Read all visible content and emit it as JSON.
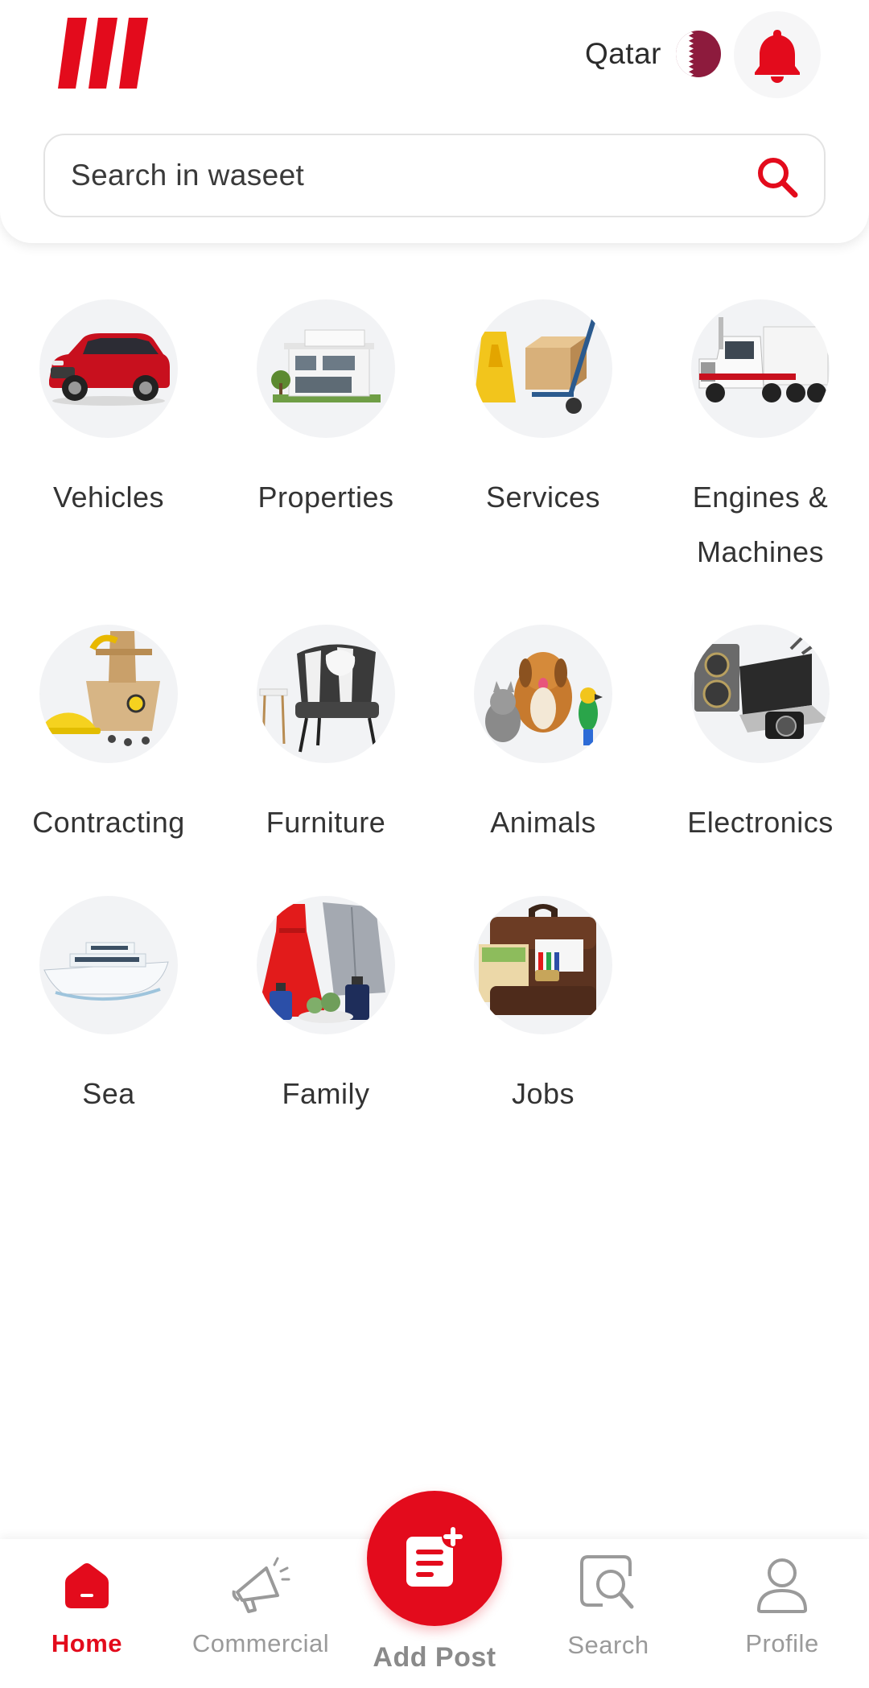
{
  "header": {
    "country": "Qatar",
    "search": {
      "placeholder": "Search in waseet"
    }
  },
  "brand_color": "#e30b1c",
  "categories": [
    {
      "label": "Vehicles",
      "icon": "car-icon"
    },
    {
      "label": "Properties",
      "icon": "house-icon"
    },
    {
      "label": "Services",
      "icon": "hand-truck-icon"
    },
    {
      "label": "Engines & Machines",
      "icon": "truck-icon"
    },
    {
      "label": "Contracting",
      "icon": "toolbox-icon"
    },
    {
      "label": "Furniture",
      "icon": "armchair-icon"
    },
    {
      "label": "Animals",
      "icon": "pets-icon"
    },
    {
      "label": "Electronics",
      "icon": "laptop-icon"
    },
    {
      "label": "Sea",
      "icon": "yacht-icon"
    },
    {
      "label": "Family",
      "icon": "clothing-icon"
    },
    {
      "label": "Jobs",
      "icon": "briefcase-icon"
    }
  ],
  "bottom_nav": {
    "home": "Home",
    "commercial": "Commercial",
    "add_post": "Add Post",
    "search": "Search",
    "profile": "Profile",
    "active": "home"
  }
}
